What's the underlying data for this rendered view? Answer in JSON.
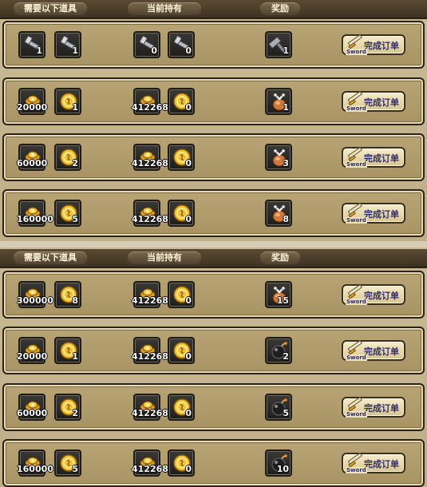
{
  "colors": {
    "panel_bg": "#c9b996",
    "row_bg": "#b9a476",
    "slot_bg": "#2a2925",
    "button_bg": "#efe2b8",
    "header_bg": "#4a3c2a"
  },
  "headers": {
    "required": "需要以下道具",
    "held": "当前持有",
    "reward": "奖励"
  },
  "button": {
    "label": "完成订单",
    "sub": "Sword"
  },
  "orders": [
    {
      "req": [
        {
          "icon": "key-icon",
          "qty": "1"
        },
        {
          "icon": "key-icon",
          "qty": "1"
        }
      ],
      "held": [
        {
          "icon": "key-icon",
          "qty": "0"
        },
        {
          "icon": "key-icon",
          "qty": "0"
        }
      ],
      "reward": {
        "icon": "hammer-icon",
        "qty": "1"
      }
    },
    {
      "req": [
        {
          "icon": "gold-coins-icon",
          "qty": "20000"
        },
        {
          "icon": "gold-medal-icon",
          "qty": "1"
        }
      ],
      "held": [
        {
          "icon": "gold-coins-icon",
          "qty": "412268"
        },
        {
          "icon": "gold-medal-icon",
          "qty": "0"
        }
      ],
      "reward": {
        "icon": "item-bag-icon",
        "qty": "1"
      }
    },
    {
      "req": [
        {
          "icon": "gold-coins-icon",
          "qty": "60000"
        },
        {
          "icon": "gold-medal-icon",
          "qty": "2"
        }
      ],
      "held": [
        {
          "icon": "gold-coins-icon",
          "qty": "412268"
        },
        {
          "icon": "gold-medal-icon",
          "qty": "0"
        }
      ],
      "reward": {
        "icon": "item-bag-icon",
        "qty": "3"
      }
    },
    {
      "req": [
        {
          "icon": "gold-coins-icon",
          "qty": "160000"
        },
        {
          "icon": "gold-medal-icon",
          "qty": "5"
        }
      ],
      "held": [
        {
          "icon": "gold-coins-icon",
          "qty": "412268"
        },
        {
          "icon": "gold-medal-icon",
          "qty": "0"
        }
      ],
      "reward": {
        "icon": "item-bag-icon",
        "qty": "8"
      }
    },
    {
      "req": [
        {
          "icon": "gold-coins-icon",
          "qty": "300000"
        },
        {
          "icon": "gold-medal-icon",
          "qty": "8"
        }
      ],
      "held": [
        {
          "icon": "gold-coins-icon",
          "qty": "412268"
        },
        {
          "icon": "gold-medal-icon",
          "qty": "0"
        }
      ],
      "reward": {
        "icon": "item-bag-icon",
        "qty": "15"
      }
    },
    {
      "req": [
        {
          "icon": "gold-coins-icon",
          "qty": "20000"
        },
        {
          "icon": "gold-medal-icon",
          "qty": "1"
        }
      ],
      "held": [
        {
          "icon": "gold-coins-icon",
          "qty": "412268"
        },
        {
          "icon": "gold-medal-icon",
          "qty": "0"
        }
      ],
      "reward": {
        "icon": "bomb-icon",
        "qty": "2"
      }
    },
    {
      "req": [
        {
          "icon": "gold-coins-icon",
          "qty": "60000"
        },
        {
          "icon": "gold-medal-icon",
          "qty": "2"
        }
      ],
      "held": [
        {
          "icon": "gold-coins-icon",
          "qty": "412268"
        },
        {
          "icon": "gold-medal-icon",
          "qty": "0"
        }
      ],
      "reward": {
        "icon": "bomb-icon",
        "qty": "5"
      }
    },
    {
      "req": [
        {
          "icon": "gold-coins-icon",
          "qty": "160000"
        },
        {
          "icon": "gold-medal-icon",
          "qty": "5"
        }
      ],
      "held": [
        {
          "icon": "gold-coins-icon",
          "qty": "412268"
        },
        {
          "icon": "gold-medal-icon",
          "qty": "0"
        }
      ],
      "reward": {
        "icon": "bomb-icon",
        "qty": "10"
      }
    }
  ]
}
